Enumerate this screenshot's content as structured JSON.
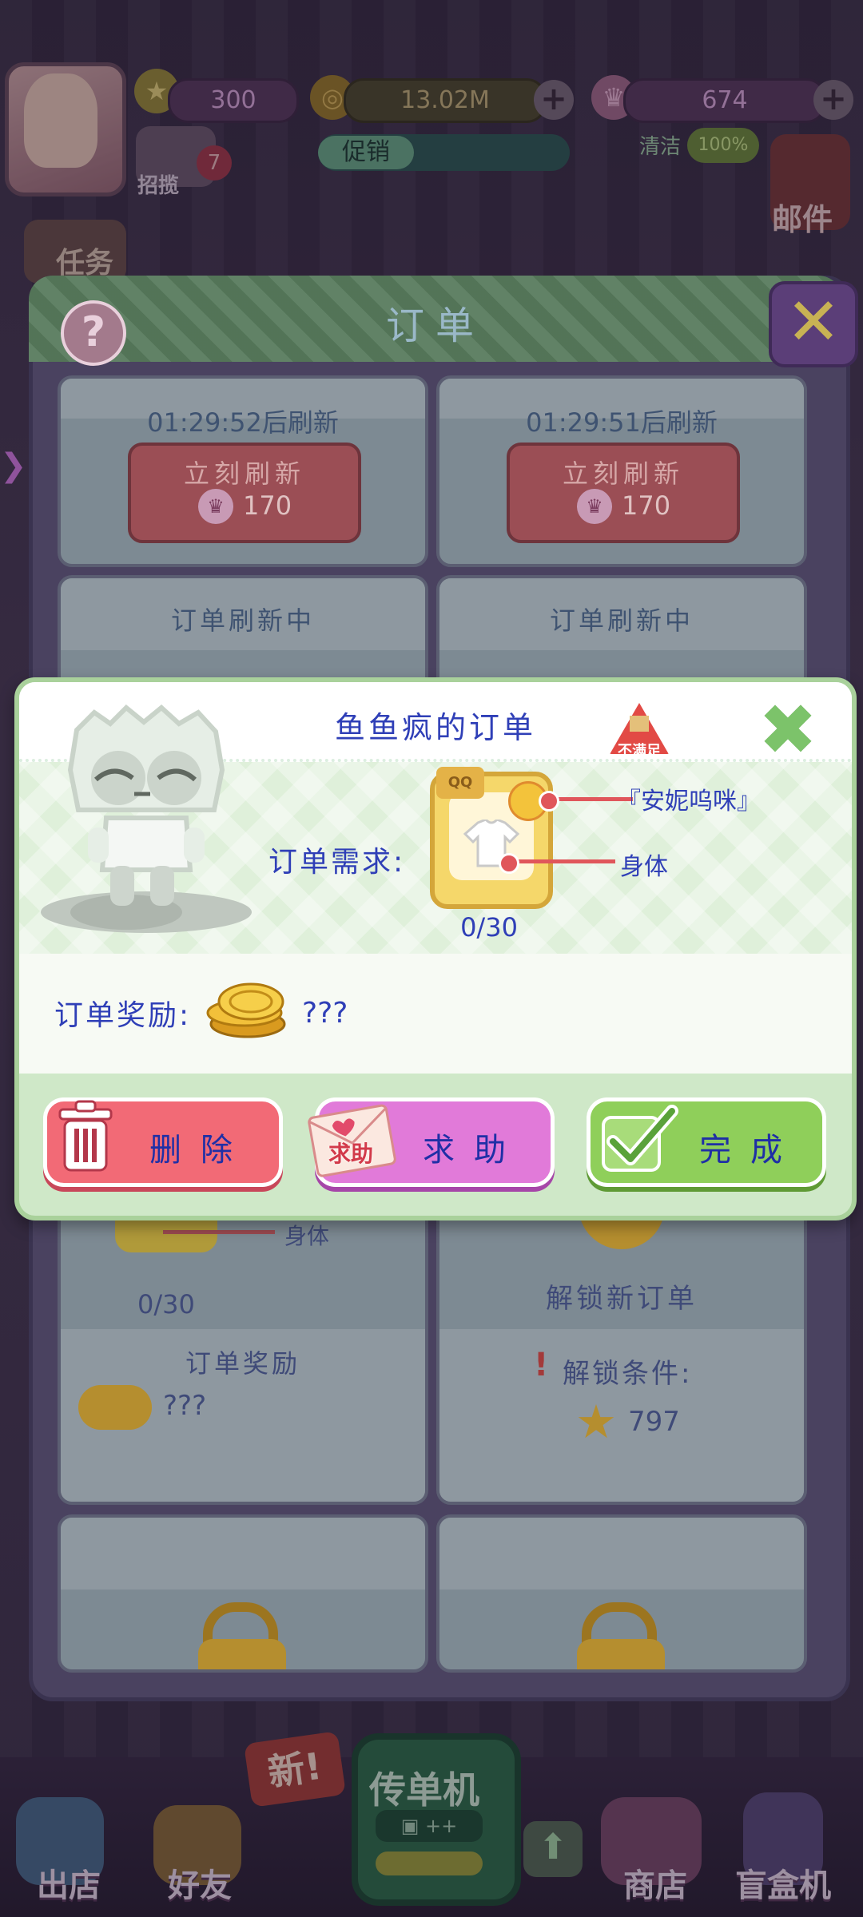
{
  "hud": {
    "stars": "300",
    "coins": "13.02M",
    "crowns": "674",
    "recruit_badge": "7",
    "recruit_label": "招揽",
    "promo_label": "促销",
    "clean_label": "清洁",
    "clean_value": "100%",
    "mail_label": "邮件",
    "task_label": "任务"
  },
  "orders_panel": {
    "title": "订单",
    "help_icon": "?",
    "cards": [
      {
        "timer": "01:29:52后刷新",
        "refresh_label": "立刻刷新",
        "refresh_cost": "170"
      },
      {
        "timer": "01:29:51后刷新",
        "refresh_label": "立刻刷新",
        "refresh_cost": "170"
      },
      {
        "status": "订单刷新中"
      },
      {
        "status": "订单刷新中"
      },
      {
        "body_label": "身体",
        "progress": "0/30",
        "reward_title": "订单奖励",
        "reward_value": "???"
      },
      {
        "title": "解锁新订单",
        "condition_label": "解锁条件:",
        "condition_value": "797"
      }
    ]
  },
  "order_detail": {
    "title": "鱼鱼疯的订单",
    "unmet_badge": "不满足",
    "requirement_label": "订单需求:",
    "item_pointer_1": "『安妮呜咪』",
    "item_pointer_2": "身体",
    "item_bag_label": "QQ",
    "progress": "0/30",
    "reward_label": "订单奖励:",
    "reward_value": "???",
    "buttons": {
      "delete": "删除",
      "help": "求助",
      "help_envelope_text": "求助",
      "done": "完成"
    }
  },
  "bottom_nav": {
    "new_badge": "新!",
    "relay_label": "传单机",
    "items": [
      "出店",
      "好友",
      "商店",
      "盲盒机"
    ]
  },
  "colors": {
    "popup_bg": "#cfe8c8",
    "title_blue": "#2f3fb7",
    "delete": "#f26a76",
    "help": "#e17ad9",
    "done": "#8fcf5a"
  }
}
